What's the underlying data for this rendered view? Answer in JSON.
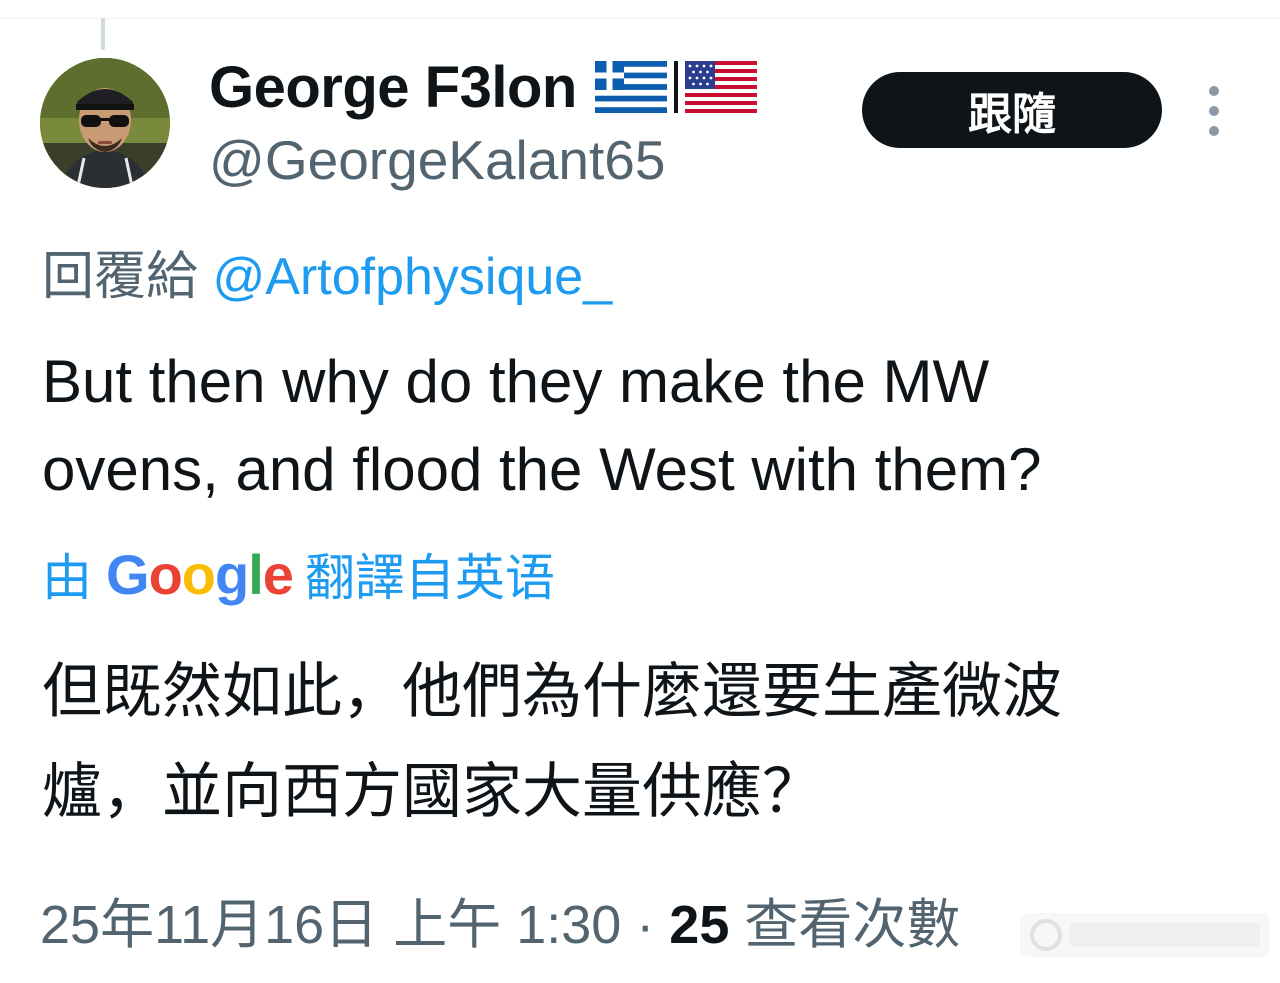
{
  "author": {
    "display_name": "George F3lon",
    "handle": "@GeorgeKalant65",
    "flags": [
      "greece-flag-icon",
      "usa-flag-icon"
    ]
  },
  "actions": {
    "follow_label": "跟隨",
    "more_icon": "more-vertical-icon"
  },
  "reply": {
    "prefix": "回覆給",
    "mention": "@Artofphysique_"
  },
  "tweet": {
    "text_line1": "But then why do they make the MW",
    "text_line2": "ovens, and flood the West with them?"
  },
  "translation": {
    "by": "由",
    "provider": "Google",
    "suffix": "翻譯自英语",
    "text_line1": "但既然如此，他們為什麼還要生產微波",
    "text_line2": "爐，並向西方國家大量供應？"
  },
  "meta": {
    "timestamp": "25年11月16日 上午 1:30 · ",
    "views_count": "25",
    "views_label": " 查看次數"
  },
  "colors": {
    "link_blue": "#1d9bf0",
    "secondary_text": "#536471",
    "primary_text": "#0f1419",
    "google_blue": "#4285f4",
    "google_red": "#ea4335",
    "google_yellow": "#fbbc05",
    "google_green": "#34a853"
  }
}
